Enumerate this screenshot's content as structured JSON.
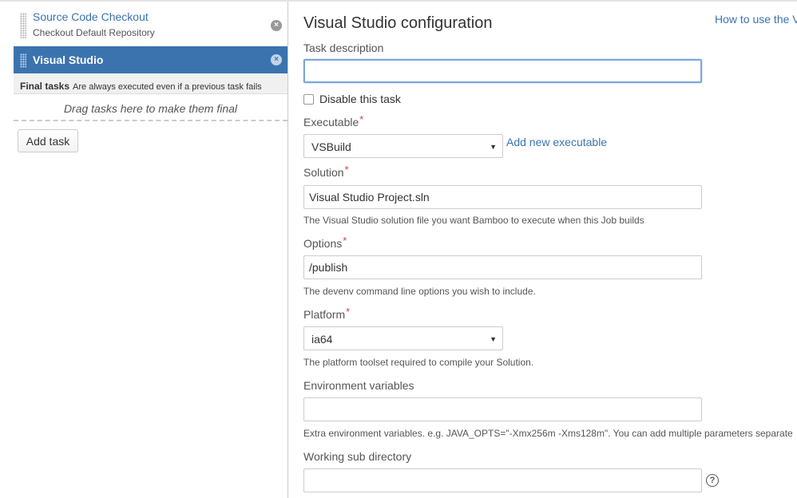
{
  "sidebar": {
    "tasks": [
      {
        "name": "Source Code Checkout",
        "description": "Checkout Default Repository"
      },
      {
        "name": "Visual Studio"
      }
    ],
    "remove_icon": "×",
    "final_tasks": {
      "title": "Final tasks",
      "note": "Are always executed even if a previous task fails",
      "drop_hint": "Drag tasks here to make them final"
    },
    "add_task_label": "Add task"
  },
  "form": {
    "title": "Visual Studio configuration",
    "help_link": "How to use the V",
    "task_description": {
      "label": "Task description",
      "value": ""
    },
    "disable_task": {
      "label": "Disable this task",
      "checked": false
    },
    "executable": {
      "label": "Executable",
      "value": "VSBuild",
      "add_link": "Add new executable"
    },
    "solution": {
      "label": "Solution",
      "value": "Visual Studio Project.sln",
      "description": "The Visual Studio solution file you want Bamboo to execute when this Job builds"
    },
    "options": {
      "label": "Options",
      "value": "/publish",
      "description": "The devenv command line options you wish to include."
    },
    "platform": {
      "label": "Platform",
      "value": "ia64",
      "description": "The platform toolset required to compile your Solution."
    },
    "env_vars": {
      "label": "Environment variables",
      "value": "",
      "description": "Extra environment variables. e.g. JAVA_OPTS=\"-Xmx256m -Xms128m\". You can add multiple parameters separate"
    },
    "working_dir": {
      "label": "Working sub directory",
      "value": ""
    },
    "required_marker": "*",
    "help_icon": "?"
  },
  "colors": {
    "accent": "#3b73af",
    "required": "#d04437",
    "focus_border": "#7ea6d9"
  }
}
